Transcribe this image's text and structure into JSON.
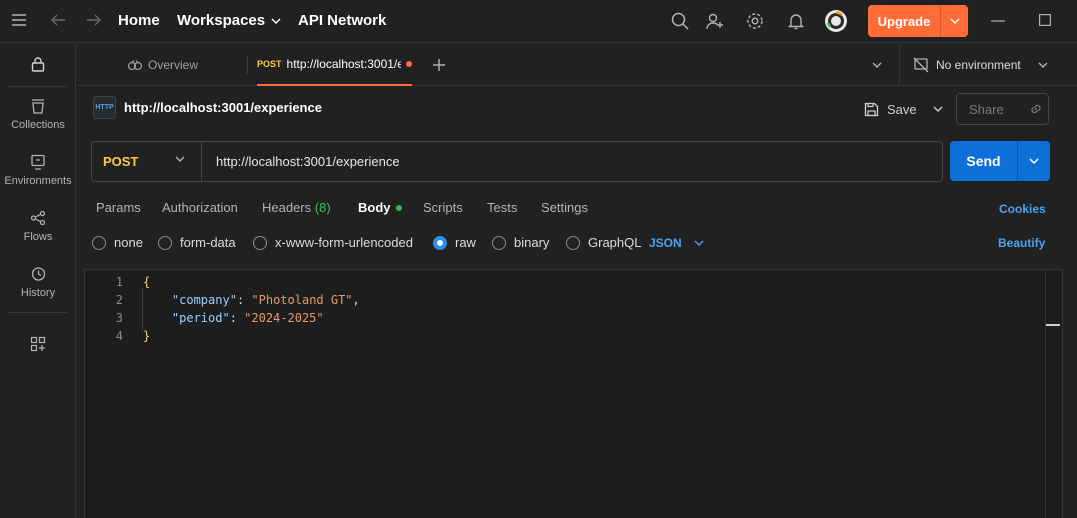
{
  "topbar": {
    "home": "Home",
    "workspaces": "Workspaces",
    "api_network": "API Network",
    "upgrade": "Upgrade"
  },
  "sidebar": {
    "items": [
      {
        "label": "Collections",
        "icon": "collections-icon"
      },
      {
        "label": "Environments",
        "icon": "environments-icon"
      },
      {
        "label": "Flows",
        "icon": "flows-icon"
      },
      {
        "label": "History",
        "icon": "history-icon"
      }
    ]
  },
  "tabs": {
    "overview": "Overview",
    "active_method": "POST",
    "active_title": "http://localhost:3001/e",
    "environment": "No environment"
  },
  "request": {
    "title": "http://localhost:3001/experience",
    "save": "Save",
    "share": "Share",
    "method": "POST",
    "url": "http://localhost:3001/experience",
    "send": "Send"
  },
  "request_tabs": {
    "params": "Params",
    "authorization": "Authorization",
    "headers": "Headers",
    "headers_count": "(8)",
    "body": "Body",
    "scripts": "Scripts",
    "tests": "Tests",
    "settings": "Settings",
    "cookies": "Cookies"
  },
  "body_types": {
    "none": "none",
    "form_data": "form-data",
    "urlencoded": "x-www-form-urlencoded",
    "raw": "raw",
    "binary": "binary",
    "graphql": "GraphQL",
    "selected": "raw",
    "format": "JSON",
    "beautify": "Beautify"
  },
  "editor": {
    "lines": [
      {
        "n": "1",
        "open": "{"
      },
      {
        "n": "2",
        "key": "\"company\"",
        "colon": ": ",
        "value": "\"Photoland GT\"",
        "comma": ","
      },
      {
        "n": "3",
        "key": "\"period\"",
        "colon": ": ",
        "value": "\"2024-2025\""
      },
      {
        "n": "4",
        "close": "}"
      }
    ]
  },
  "colors": {
    "accent": "#ff6c37",
    "send": "#0f6fd8",
    "post": "#ffc94a",
    "link": "#4aa3f0"
  }
}
